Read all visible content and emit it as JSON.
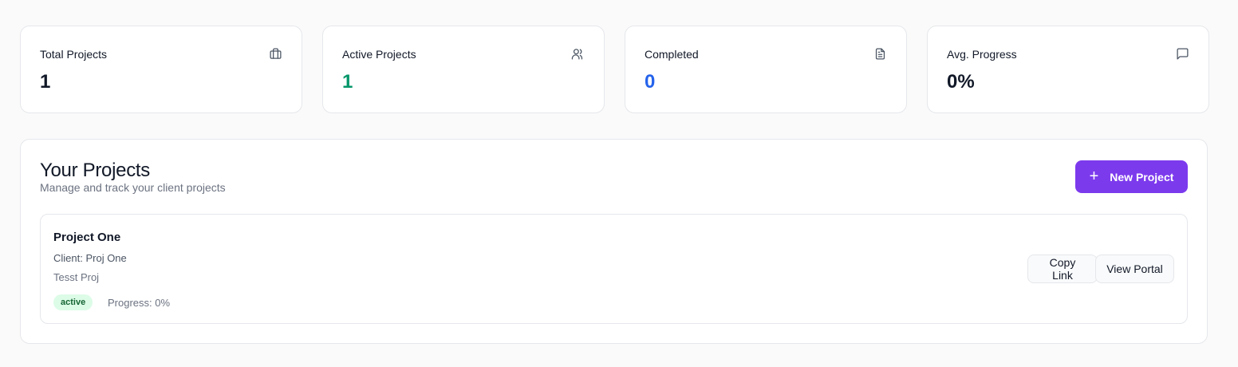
{
  "stats": [
    {
      "label": "Total Projects",
      "value": "1",
      "icon": "briefcase-icon",
      "color": "#111827"
    },
    {
      "label": "Active Projects",
      "value": "1",
      "icon": "users-icon",
      "color": "#059669"
    },
    {
      "label": "Completed",
      "value": "0",
      "icon": "file-text-icon",
      "color": "#2563eb"
    },
    {
      "label": "Avg. Progress",
      "value": "0%",
      "icon": "message-square-icon",
      "color": "#111827"
    }
  ],
  "projects_section": {
    "title": "Your Projects",
    "subtitle": "Manage and track your client projects",
    "new_button_label": "New Project",
    "accent_color": "#7c3aed"
  },
  "projects": [
    {
      "name": "Project One",
      "client": "Client: Proj One",
      "description": "Tesst Proj",
      "status": "active",
      "progress_text": "Progress: 0%",
      "progress": 0,
      "copy_link_label": "Copy Link",
      "view_portal_label": "View Portal"
    }
  ]
}
